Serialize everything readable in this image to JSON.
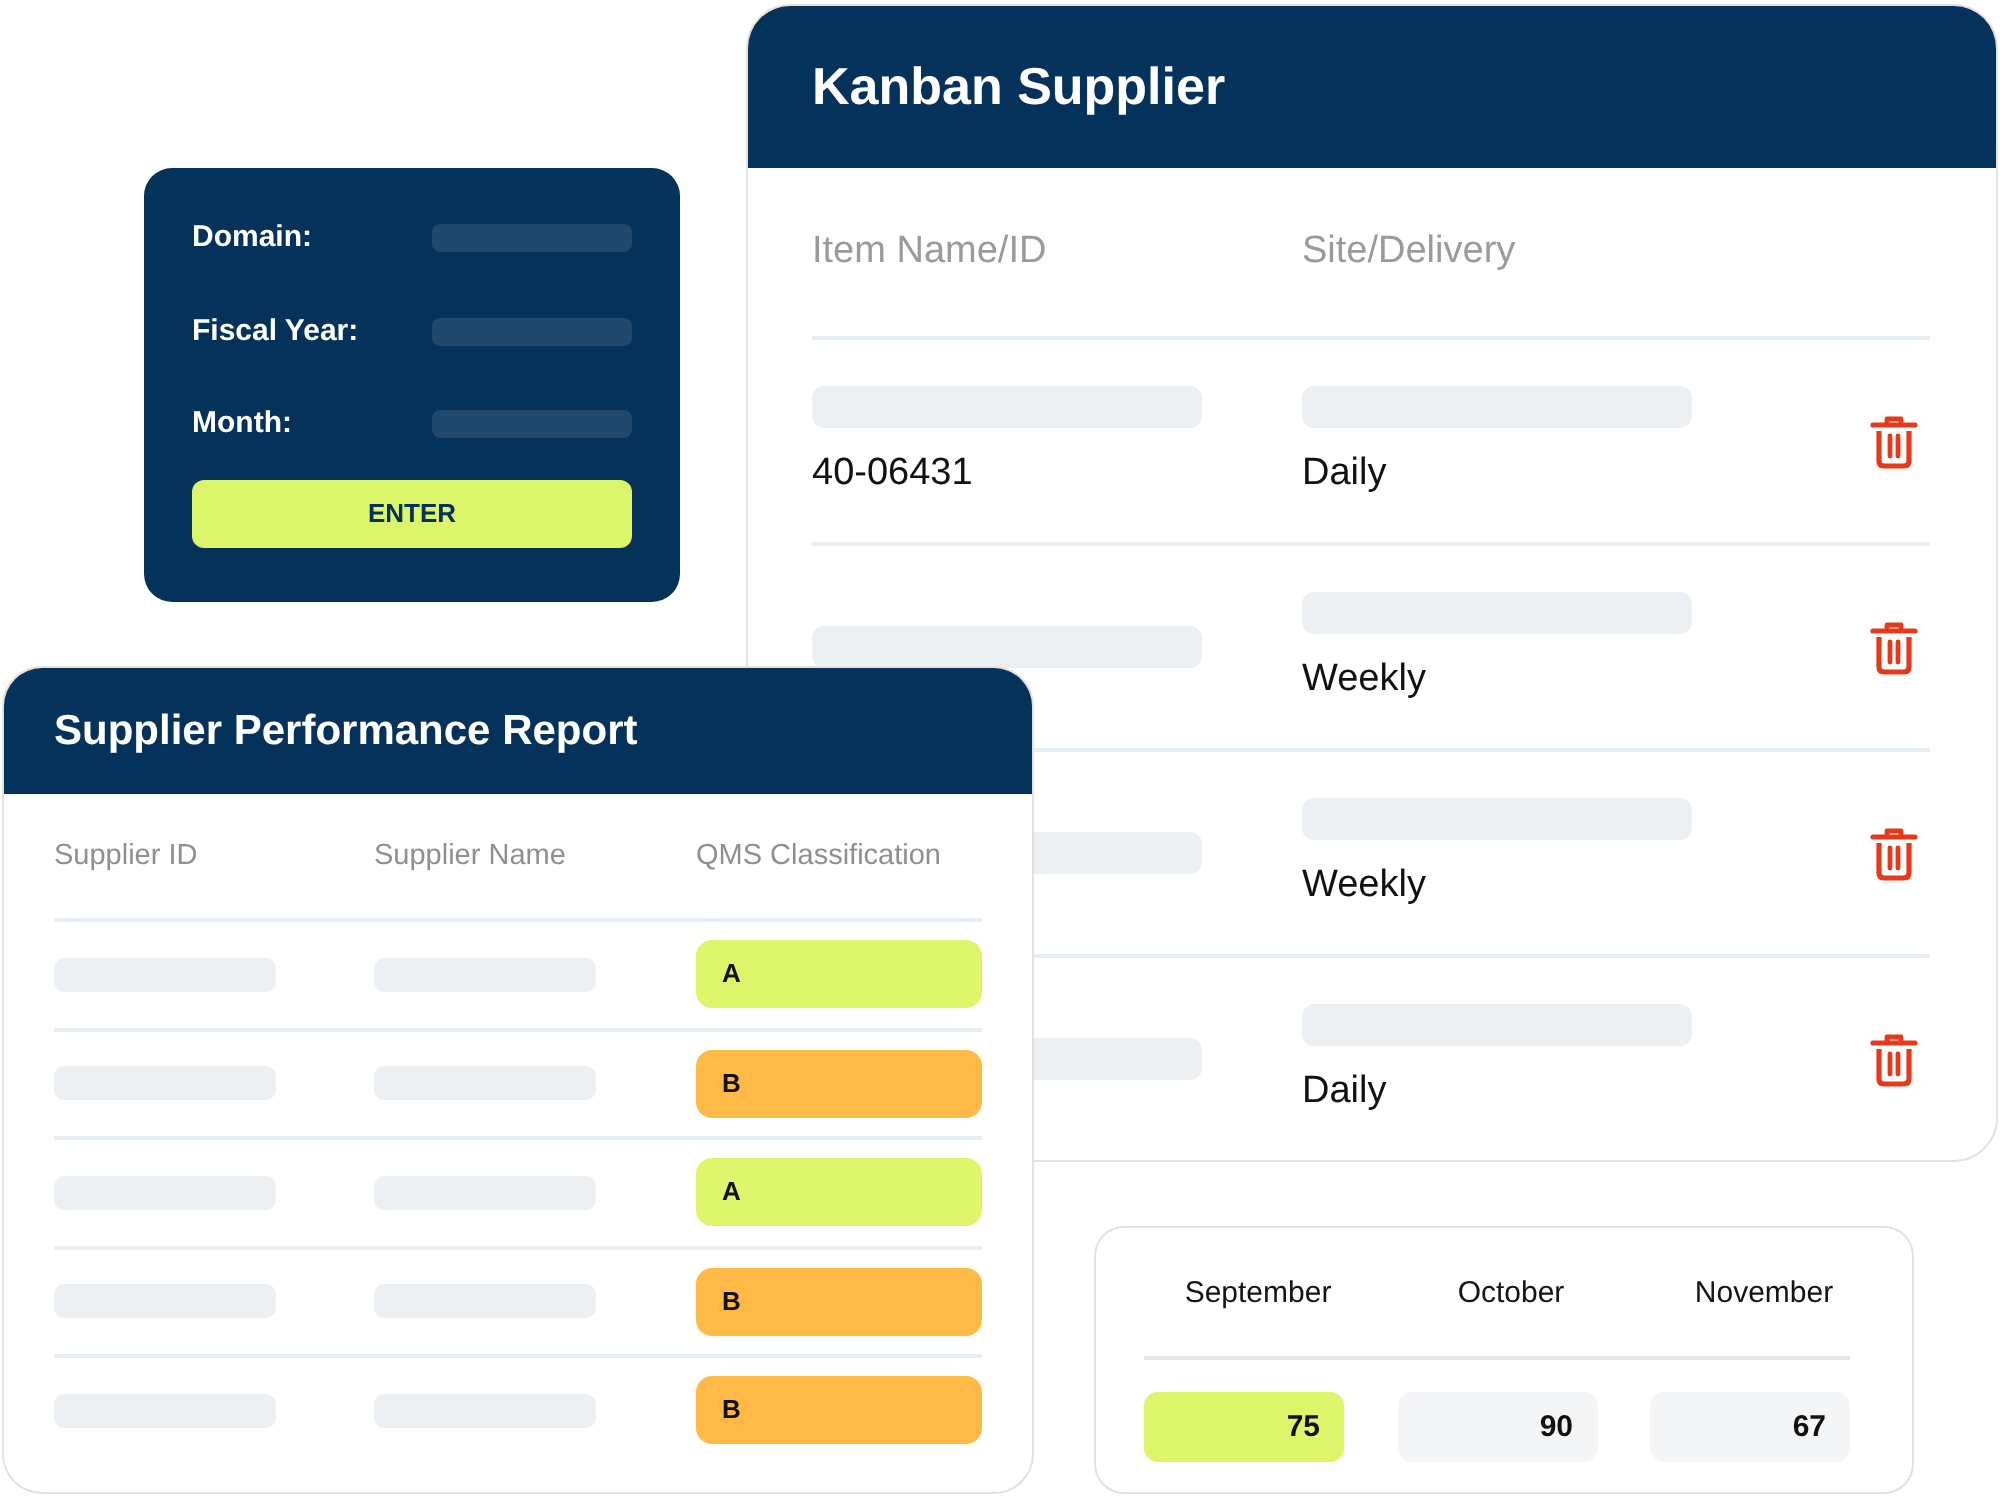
{
  "filter_panel": {
    "fields": [
      {
        "label": "Domain:"
      },
      {
        "label": "Fiscal Year:"
      },
      {
        "label": "Month:"
      }
    ],
    "button": "ENTER"
  },
  "kanban_supplier": {
    "title": "Kanban Supplier",
    "columns": [
      "Item Name/ID",
      "Site/Delivery"
    ],
    "rows": [
      {
        "item": "40-06431",
        "delivery": "Daily"
      },
      {
        "delivery": "Weekly"
      },
      {
        "delivery": "Weekly"
      },
      {
        "delivery": "Daily"
      }
    ]
  },
  "supplier_report": {
    "title": "Supplier Performance Report",
    "columns": [
      "Supplier ID",
      "Supplier Name",
      "QMS Classification"
    ],
    "rows": [
      {
        "classification": "A",
        "color": "#dcf56b"
      },
      {
        "classification": "B",
        "color": "#ffb946"
      },
      {
        "classification": "A",
        "color": "#dcf56b"
      },
      {
        "classification": "B",
        "color": "#ffb946"
      },
      {
        "classification": "B",
        "color": "#ffb946"
      }
    ]
  },
  "monthly_scores": {
    "months": [
      {
        "month": "September",
        "value": "75",
        "highlighted": true
      },
      {
        "month": "October",
        "value": "90",
        "highlighted": false
      },
      {
        "month": "November",
        "value": "67",
        "highlighted": false
      }
    ]
  }
}
